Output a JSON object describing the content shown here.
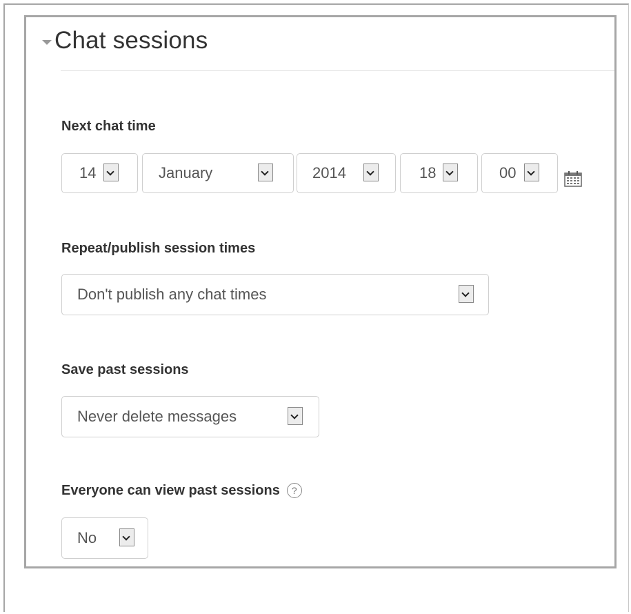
{
  "legend": {
    "title": "Chat sessions"
  },
  "next_chat_time": {
    "label": "Next chat time",
    "day": "14",
    "month": "January",
    "year": "2014",
    "hour": "18",
    "minute": "00"
  },
  "repeat": {
    "label": "Repeat/publish session times",
    "value": "Don't publish any chat times"
  },
  "save_past": {
    "label": "Save past sessions",
    "value": "Never delete messages"
  },
  "view_past": {
    "label": "Everyone can view past sessions",
    "help_glyph": "?",
    "value": "No"
  },
  "icons": {
    "legend_toggle": "caret-down-icon",
    "calendar": "calendar-icon",
    "help": "help-icon",
    "dropdown": "chevron-down-icon"
  },
  "colors": {
    "border": "#a6a6a6",
    "text": "#333333",
    "select_text": "#555555"
  }
}
